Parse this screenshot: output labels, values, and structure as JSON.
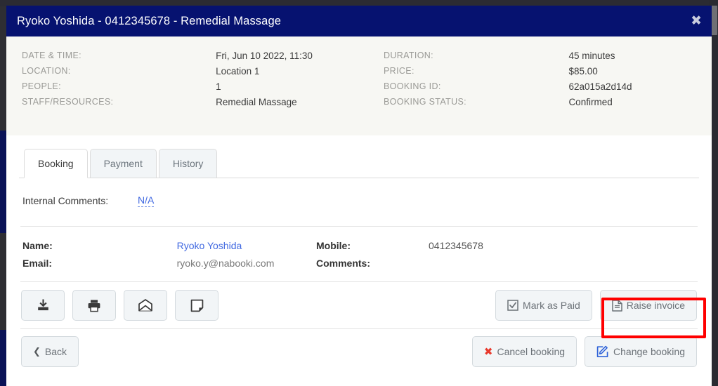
{
  "header": {
    "title": "Ryoko Yoshida - 0412345678 - Remedial Massage",
    "close_label": "✖",
    "close_icon": "close-icon",
    "bg_color": "#061270"
  },
  "summary": {
    "left": [
      {
        "label": "DATE & TIME:",
        "value": "Fri, Jun 10 2022, 11:30"
      },
      {
        "label": "LOCATION:",
        "value": "Location 1"
      },
      {
        "label": "PEOPLE:",
        "value": "1"
      },
      {
        "label": "STAFF/RESOURCES:",
        "value": "Remedial Massage"
      }
    ],
    "right": [
      {
        "label": "DURATION:",
        "value": "45 minutes"
      },
      {
        "label": "PRICE:",
        "value": "$85.00"
      },
      {
        "label": "BOOKING ID:",
        "value": "62a015a2d14d"
      },
      {
        "label": "BOOKING STATUS:",
        "value": "Confirmed"
      }
    ]
  },
  "tabs": [
    {
      "label": "Booking",
      "active": true
    },
    {
      "label": "Payment",
      "active": false
    },
    {
      "label": "History",
      "active": false
    }
  ],
  "internal_comments": {
    "label": "Internal Comments:",
    "value": "N/A"
  },
  "contact": {
    "name_label": "Name:",
    "name_value": "Ryoko Yoshida",
    "email_label": "Email:",
    "email_value": "ryoko.y@nabooki.com",
    "mobile_label": "Mobile:",
    "mobile_value": "0412345678",
    "comments_label": "Comments:",
    "comments_value": ""
  },
  "icon_buttons": [
    {
      "name": "download-icon",
      "title": "Download"
    },
    {
      "name": "print-icon",
      "title": "Print"
    },
    {
      "name": "envelope-icon",
      "title": "Email"
    },
    {
      "name": "note-icon",
      "title": "Note"
    }
  ],
  "actions": {
    "mark_as_paid": "Mark as Paid",
    "raise_invoice": "Raise invoice",
    "back": "Back",
    "cancel_booking": "Cancel booking",
    "change_booking": "Change booking"
  },
  "highlight": {
    "target": "raise-invoice",
    "color": "#ff0000"
  }
}
